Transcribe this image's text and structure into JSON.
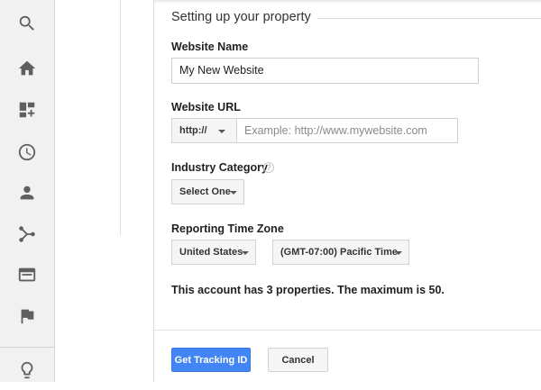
{
  "rail": {
    "items": [
      "search",
      "home",
      "customization",
      "realtime",
      "audience",
      "acquisition",
      "behavior",
      "conversions",
      "discover"
    ]
  },
  "form": {
    "section_title": "Setting up your property",
    "website_name": {
      "label": "Website Name",
      "value": "My New Website"
    },
    "website_url": {
      "label": "Website URL",
      "protocol": "http://",
      "placeholder": "Example: http://www.mywebsite.com"
    },
    "industry": {
      "label": "Industry Category",
      "help": "?",
      "selected": "Select One"
    },
    "timezone": {
      "label": "Reporting Time Zone",
      "country": "United States",
      "zone": "(GMT-07:00) Pacific Time"
    },
    "note": "This account has 3 properties. The maximum is 50."
  },
  "actions": {
    "primary": "Get Tracking ID",
    "secondary": "Cancel"
  },
  "colors": {
    "accent": "#4285f4",
    "rail_bg": "#f1f1f1"
  }
}
